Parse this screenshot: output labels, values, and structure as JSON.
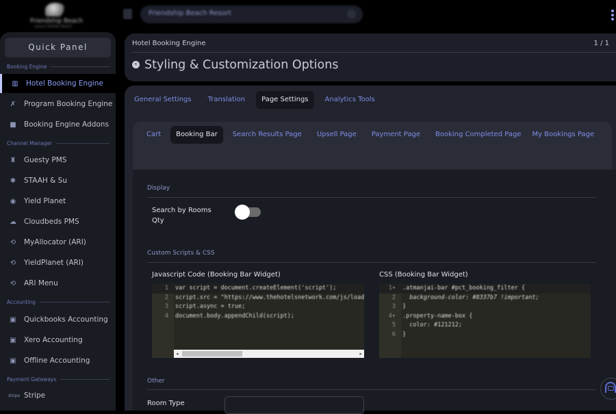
{
  "topbar": {
    "logo_name": "Friendship Beach",
    "logo_sub": "Luxury Holiday Resort",
    "search_value": "Friendship Beach Resort"
  },
  "sidebar": {
    "quick_panel_label": "Quick Panel",
    "sections": [
      {
        "title": "Booking Engine",
        "items": [
          {
            "label": "Hotel Booking Engine",
            "icon": "building-icon",
            "active": true
          },
          {
            "label": "Program Booking Engine",
            "icon": "running-icon"
          },
          {
            "label": "Booking Engine Addons",
            "icon": "bag-icon"
          }
        ]
      },
      {
        "title": "Channel Manager",
        "items": [
          {
            "label": "Guesty PMS",
            "icon": "hotel-icon"
          },
          {
            "label": "STAAH & Su",
            "icon": "asterisk-icon"
          },
          {
            "label": "Yield Planet",
            "icon": "globe-icon"
          },
          {
            "label": "Cloudbeds PMS",
            "icon": "cloud-icon"
          },
          {
            "label": "MyAllocator (ARI)",
            "icon": "sync-icon"
          },
          {
            "label": "YieldPlanet (ARI)",
            "icon": "sync-icon"
          },
          {
            "label": "ARI Menu",
            "icon": "sync-icon"
          }
        ]
      },
      {
        "title": "Accounting",
        "items": [
          {
            "label": "Quickbooks Accounting",
            "icon": "cash-register-icon"
          },
          {
            "label": "Xero Accounting",
            "icon": "cash-register-icon"
          },
          {
            "label": "Offline Accounting",
            "icon": "cash-register-icon"
          }
        ]
      },
      {
        "title": "Payment Gateways",
        "items": [
          {
            "label": "Stripe",
            "icon": "stripe-icon"
          }
        ]
      }
    ]
  },
  "header": {
    "breadcrumb": "Hotel Booking Engine",
    "pager": "1 / 1",
    "title": "Styling & Customization Options"
  },
  "main_tabs": [
    {
      "label": "General Settings"
    },
    {
      "label": "Translation"
    },
    {
      "label": "Page Settings",
      "active": true
    },
    {
      "label": "Analytics Tools"
    }
  ],
  "page_tabs": [
    {
      "label": "Cart"
    },
    {
      "label": "Booking Bar",
      "active": true
    },
    {
      "label": "Search Results Page"
    },
    {
      "label": "Upsell Page"
    },
    {
      "label": "Payment Page"
    },
    {
      "label": "Booking Completed Page"
    },
    {
      "label": "My Bookings Page"
    }
  ],
  "display": {
    "section_title": "Display",
    "search_by_rooms_label": "Search by Rooms Qty",
    "search_by_rooms_enabled": false
  },
  "custom": {
    "section_title": "Custom Scripts & CSS",
    "js_label": "Javascript Code (Booking Bar Widget)",
    "js_lines": [
      "var script = document.createElement('script');",
      "script.src = \"https://www.thehotelsnetwork.com/js/loader.js\";",
      "script.async = true;",
      "document.body.appendChild(script);"
    ],
    "css_label": "CSS (Booking Bar Widget)",
    "css_lines": [
      ".atmanjai-bar #pct_booking_filter {",
      "  background-color: #8337b7 !important;",
      "}",
      ".property-name-box {",
      "  color: #121212;",
      "}"
    ]
  },
  "other": {
    "section_title": "Other",
    "room_type_label": "Room Type",
    "room_type_value": ""
  },
  "colors": {
    "accent": "#7f8de6",
    "background": "#1a1c23"
  }
}
